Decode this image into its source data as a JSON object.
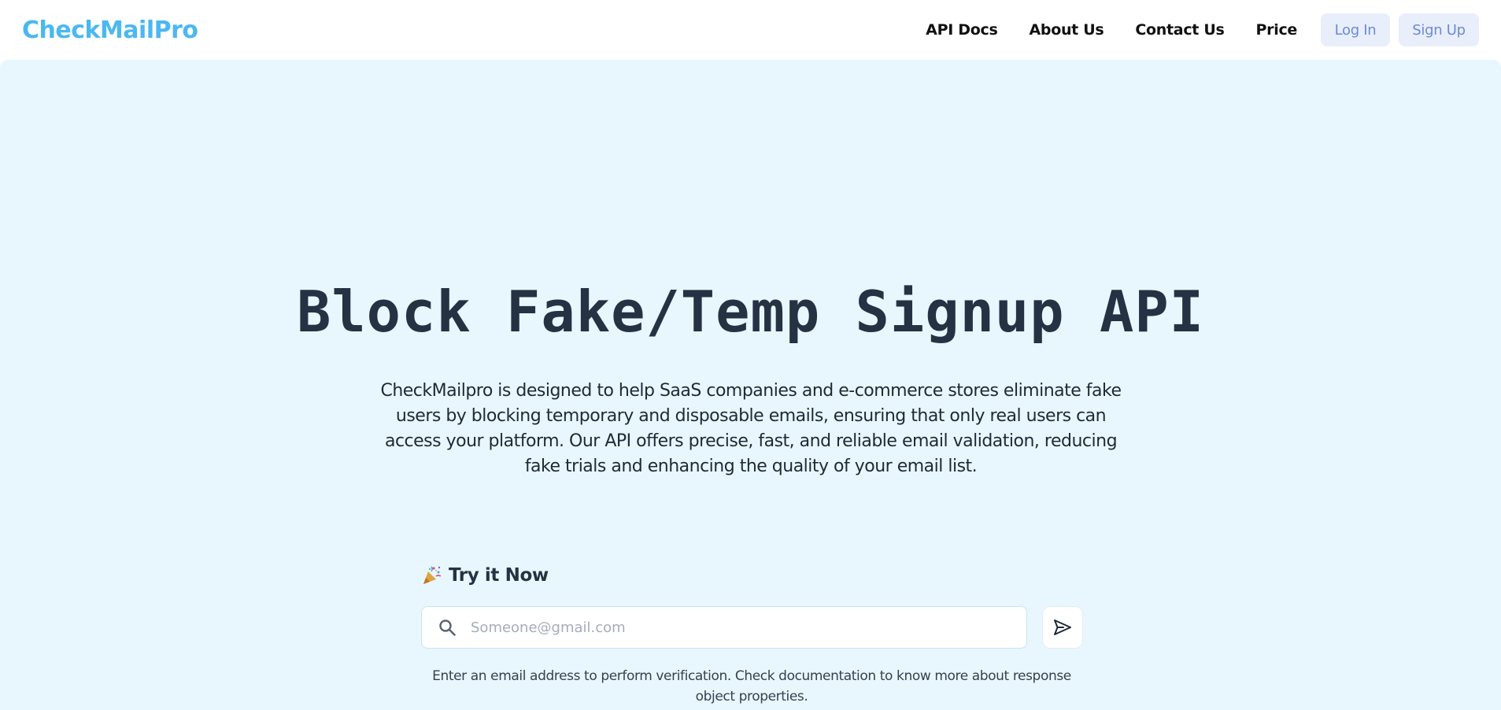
{
  "header": {
    "logo": "CheckMailPro",
    "nav": {
      "api_docs": "API Docs",
      "about_us": "About Us",
      "contact_us": "Contact Us",
      "price": "Price"
    },
    "login_label": "Log In",
    "signup_label": "Sign Up"
  },
  "hero": {
    "title": "Block Fake/Temp Signup API",
    "description": "CheckMailpro is designed to help SaaS companies and e-commerce stores eliminate fake users by blocking temporary and disposable emails, ensuring that only real users can access your platform. Our API offers precise, fast, and reliable email validation, reducing fake trials and enhancing the quality of your email list."
  },
  "try_it": {
    "label": "Try it Now",
    "icon": "party-popper-icon",
    "input_value": "",
    "input_placeholder": "Someone@gmail.com",
    "helper_text": "Enter an email address to perform verification. Check documentation to know more about response object properties."
  },
  "icons": {
    "search": "search-icon",
    "send": "send-icon"
  },
  "colors": {
    "brand": "#4cb8f0",
    "hero_background": "#e8f7fd",
    "auth_button_bg": "#e9eefb",
    "auth_button_text": "#6b8bd6",
    "title_text": "#243244"
  }
}
